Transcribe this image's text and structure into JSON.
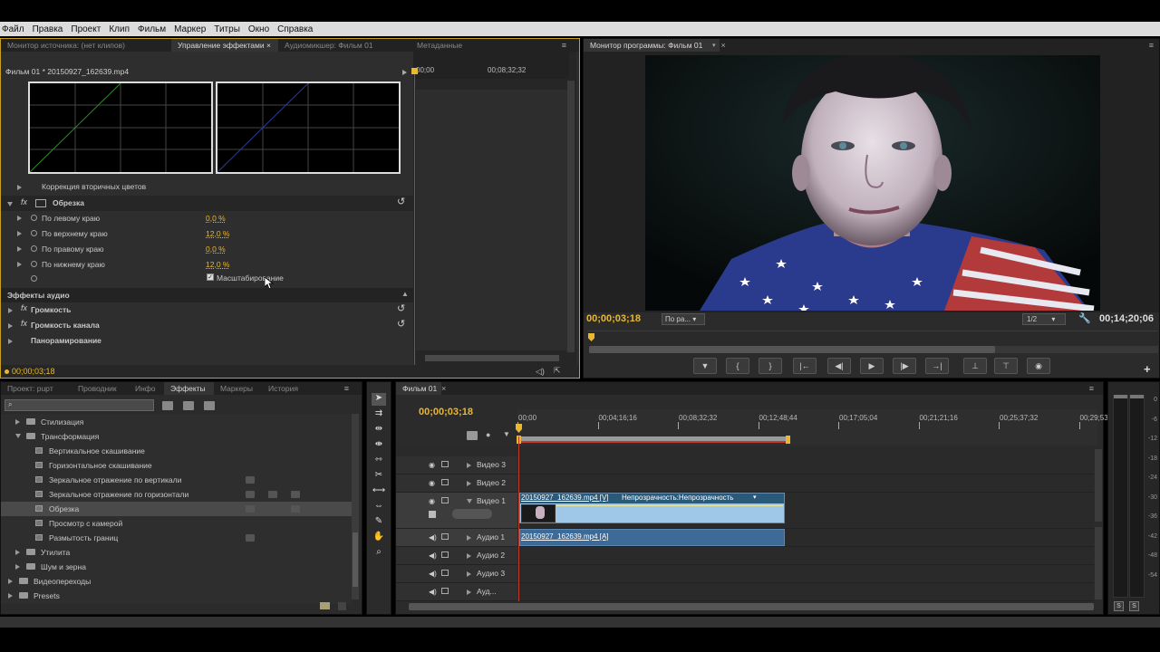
{
  "menu": [
    "Файл",
    "Правка",
    "Проект",
    "Клип",
    "Фильм",
    "Маркер",
    "Титры",
    "Окно",
    "Справка"
  ],
  "top_left_tabs": {
    "source": "Монитор источника: (нет клипов)",
    "effects_control": "Управление эффектами",
    "audio_mixer": "Аудиомикшер: Фильм 01",
    "metadata": "Метаданные"
  },
  "effect_controls": {
    "clip_name": "Фильм 01 * 20150927_162639.mp4",
    "tc_start": "00;00",
    "tc_mid": "00;08;32;32",
    "secondary_color": "Коррекция вторичных цветов",
    "crop_label": "Обрезка",
    "params": [
      {
        "label": "По левому краю",
        "value": "0,0 %"
      },
      {
        "label": "По верхнему краю",
        "value": "12,0 %"
      },
      {
        "label": "По правому краю",
        "value": "0,0 %"
      },
      {
        "label": "По нижнему краю",
        "value": "12,0 %"
      }
    ],
    "scale_label": "Масштабирование",
    "audio_effects": "Эффекты аудио",
    "volume": "Громкость",
    "channel_volume": "Громкость канала",
    "panner": "Панорамирование",
    "timecode": "00;00;03;18"
  },
  "program_monitor": {
    "title": "Монитор программы: Фильм 01",
    "timecode": "00;00;03;18",
    "fit": "По ра...",
    "resolution": "1/2",
    "duration": "00;14;20;06",
    "transport_icons": [
      "marker",
      "in",
      "out",
      "go-in",
      "step-back",
      "play",
      "step-forward",
      "go-out",
      "lift",
      "extract",
      "export-frame"
    ]
  },
  "effects_panel": {
    "tabs": [
      "Проект: pupт",
      "Проводник",
      "Инфо",
      "Эффекты",
      "Маркеры",
      "История"
    ],
    "search_placeholder": "",
    "items": [
      {
        "label": "Стилизация",
        "level": 1,
        "type": "folder",
        "open": false
      },
      {
        "label": "Трансформация",
        "level": 1,
        "type": "folder",
        "open": true
      },
      {
        "label": "Вертикальное скашивание",
        "level": 2,
        "type": "fx"
      },
      {
        "label": "Горизонтальное скашивание",
        "level": 2,
        "type": "fx"
      },
      {
        "label": "Зеркальное отражение по вертикали",
        "level": 2,
        "type": "fx"
      },
      {
        "label": "Зеркальное отражение по горизонтали",
        "level": 2,
        "type": "fx"
      },
      {
        "label": "Обрезка",
        "level": 2,
        "type": "fx",
        "selected": true
      },
      {
        "label": "Просмотр с камерой",
        "level": 2,
        "type": "fx"
      },
      {
        "label": "Размытость границ",
        "level": 2,
        "type": "fx"
      },
      {
        "label": "Утилита",
        "level": 1,
        "type": "folder",
        "open": false
      },
      {
        "label": "Шум и зерна",
        "level": 1,
        "type": "folder",
        "open": false
      },
      {
        "label": "Видеопереходы",
        "level": 0,
        "type": "folder",
        "open": false
      },
      {
        "label": "Presets",
        "level": 0,
        "type": "folder",
        "open": false
      }
    ]
  },
  "timeline": {
    "tab": "Фильм 01",
    "timecode": "00;00;03;18",
    "ruler": [
      "00;00",
      "00;04;16;16",
      "00;08;32;32",
      "00;12;48;44",
      "00;17;05;04",
      "00;21;21;16",
      "00;25;37;32",
      "00;29;53;"
    ],
    "tracks": [
      {
        "name": "Видео 3",
        "type": "video"
      },
      {
        "name": "Видео 2",
        "type": "video"
      },
      {
        "name": "Видео 1",
        "type": "video",
        "expanded": true
      },
      {
        "name": "Аудио 1",
        "type": "audio"
      },
      {
        "name": "Аудио 2",
        "type": "audio"
      },
      {
        "name": "Аудио 3",
        "type": "audio"
      },
      {
        "name": "Ауд...",
        "type": "audio"
      }
    ],
    "video_clip": "20150927_162639.mp4 [V]",
    "opacity_label": "Непрозрачность:Непрозрачность",
    "audio_clip": "20150927_162639.mp4 [A]"
  },
  "meter": {
    "labels": [
      "0",
      "-6",
      "-12",
      "-18",
      "-24",
      "-30",
      "-36",
      "-42",
      "-48",
      "-54"
    ],
    "solo": "S"
  },
  "colors": {
    "accent": "#e8b830",
    "clip_video": "#9fc8e8",
    "clip_audio": "#3d6a96",
    "playhead": "#c03a2a"
  }
}
